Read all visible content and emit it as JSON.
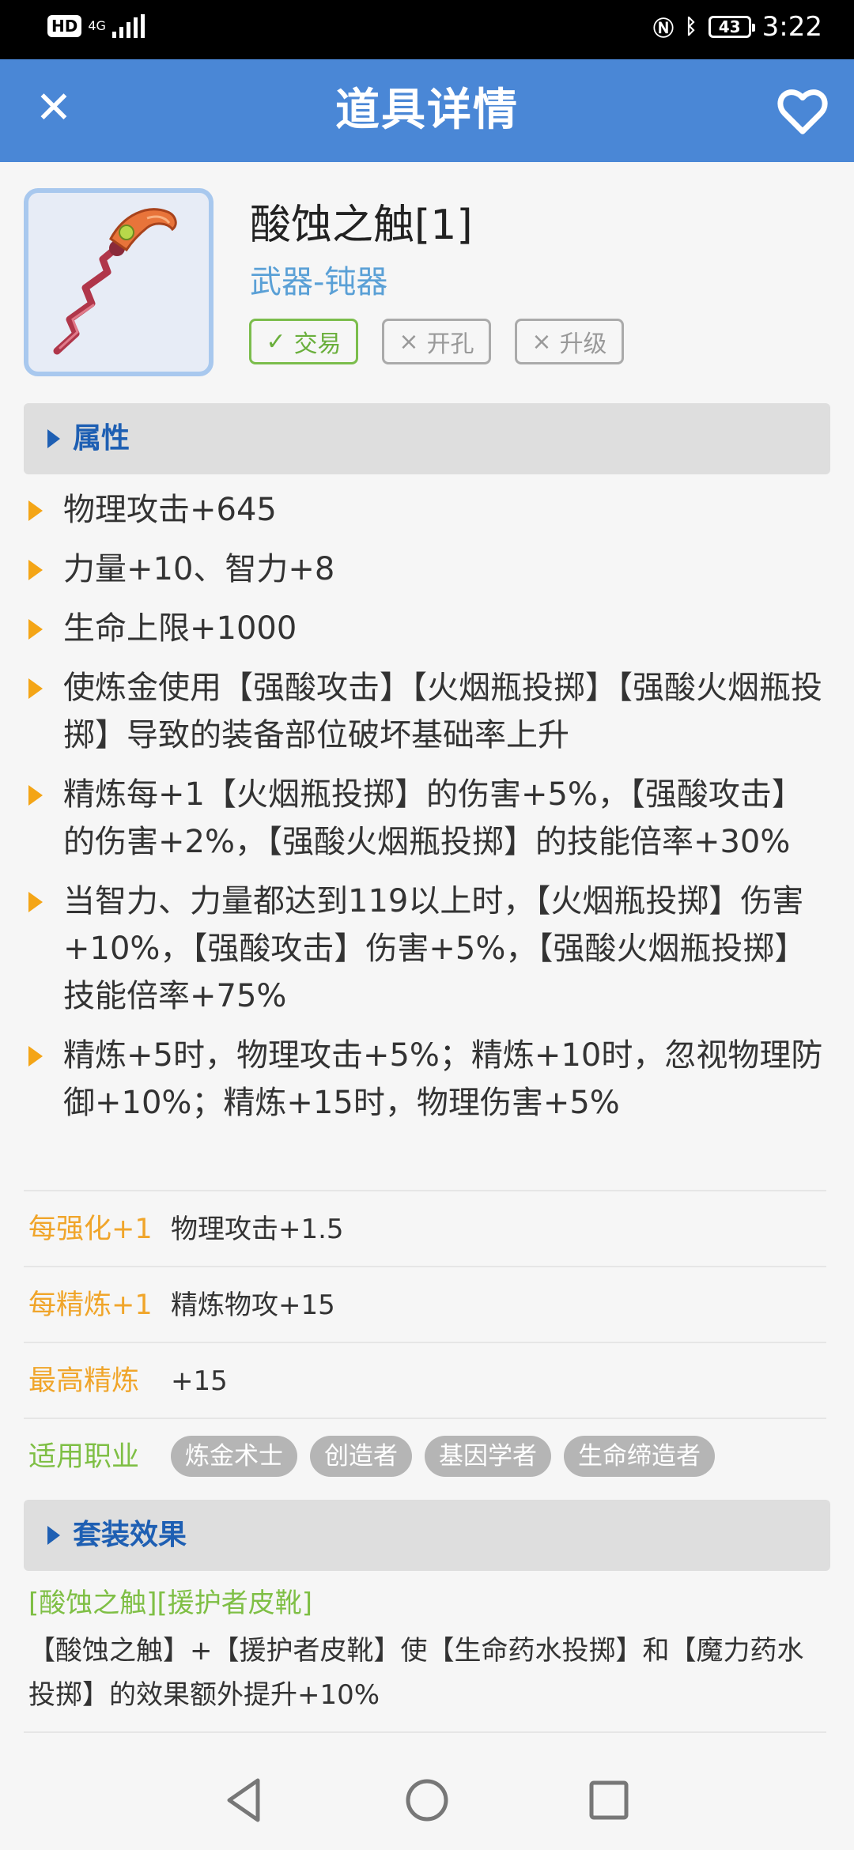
{
  "status_bar": {
    "hd": "HD",
    "network": "4G",
    "battery": "43",
    "time": "3:22"
  },
  "app_bar": {
    "title": "道具详情",
    "close_icon": "close-icon",
    "favorite_icon": "heart-outline-icon"
  },
  "item": {
    "name": "酸蚀之触[1]",
    "type": "武器-钝器",
    "tags": [
      {
        "label": "交易",
        "enabled": true
      },
      {
        "label": "开孔",
        "enabled": false
      },
      {
        "label": "升级",
        "enabled": false
      }
    ]
  },
  "attributes_section": {
    "label": "属性",
    "items": [
      "物理攻击+645",
      "力量+10、智力+8",
      "生命上限+1000",
      "使炼金使用【强酸攻击】【火烟瓶投掷】【强酸火烟瓶投掷】导致的装备部位破坏基础率上升",
      "精炼每+1【火烟瓶投掷】的伤害+5%，【强酸攻击】的伤害+2%，【强酸火烟瓶投掷】的技能倍率+30%",
      "当智力、力量都达到119以上时，【火烟瓶投掷】伤害+10%，【强酸攻击】伤害+5%，【强酸火烟瓶投掷】技能倍率+75%",
      "精炼+5时，物理攻击+5%；精炼+10时，忽视物理防御+10%；精炼+15时，物理伤害+5%"
    ]
  },
  "stats": {
    "enhance": {
      "label": "每强化+1",
      "value": "物理攻击+1.5"
    },
    "refine": {
      "label": "每精炼+1",
      "value": "精炼物攻+15"
    },
    "max_refine": {
      "label": "最高精炼",
      "value": "+15"
    },
    "jobs": {
      "label": "适用职业",
      "values": [
        "炼金术士",
        "创造者",
        "基因学者",
        "生命缔造者"
      ]
    }
  },
  "set_section": {
    "label": "套装效果",
    "title": "[酸蚀之触][援护者皮靴]",
    "description": "【酸蚀之触】+【援护者皮靴】使【生命药水投掷】和【魔力药水投掷】的效果额外提升+10%"
  },
  "nav_bar": {
    "icons": [
      "back-triangle-icon",
      "home-circle-icon",
      "recents-square-icon"
    ]
  },
  "colors": {
    "app_bar": "#4a87d6",
    "section_label": "#1e5fb3",
    "bullet": "#f4a516",
    "stat_label": "#f0a52a",
    "green": "#7fbf45"
  }
}
